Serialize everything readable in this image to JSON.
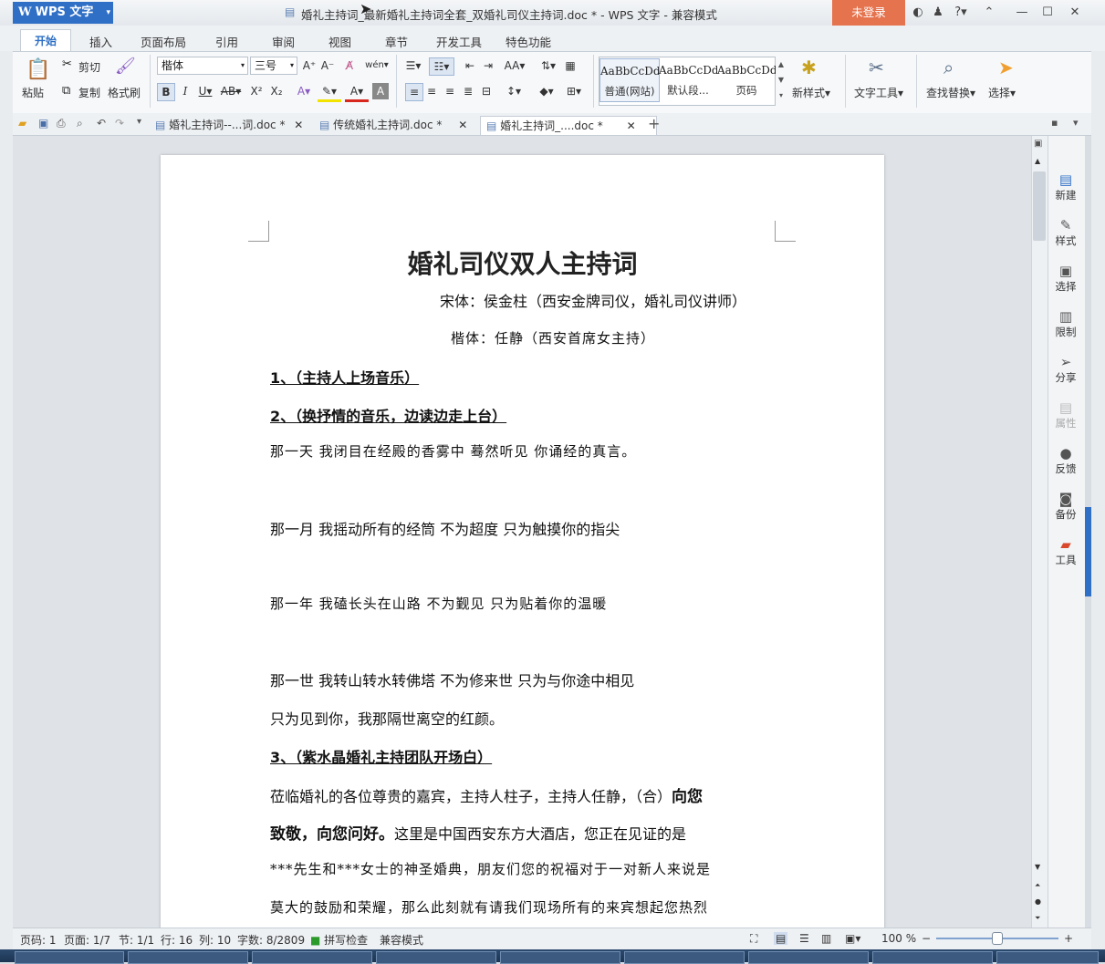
{
  "titlebar": {
    "app_name": "WPS 文字",
    "title": "婚礼主持词_最新婚礼主持词全套_双婚礼司仪主持词.doc * - WPS 文字 - 兼容模式",
    "login": "未登录"
  },
  "menu": {
    "tabs": [
      "开始",
      "插入",
      "页面布局",
      "引用",
      "审阅",
      "视图",
      "章节",
      "开发工具",
      "特色功能"
    ]
  },
  "ribbon": {
    "paste": "粘贴",
    "cut": "剪切",
    "copy": "复制",
    "format_painter": "格式刷",
    "font_name": "楷体",
    "font_size": "三号",
    "styles": [
      {
        "sample": "AaBbCcDd",
        "name": "普通(网站)"
      },
      {
        "sample": "AaBbCcDd",
        "name": "默认段..."
      },
      {
        "sample": "AaBbCcDd",
        "name": "页码"
      }
    ],
    "new_style": "新样式",
    "text_tools": "文字工具",
    "find_replace": "查找替换",
    "select": "选择"
  },
  "doctabs": [
    {
      "label": "婚礼主持词--...词.doc *"
    },
    {
      "label": "传统婚礼主持词.doc *"
    },
    {
      "label": "婚礼主持词_....doc *"
    }
  ],
  "document": {
    "title": "婚礼司仪双人主持词",
    "line1": "宋体：侯金柱（西安金牌司仪，婚礼司仪讲师）",
    "line2": "楷体：任静（西安首席女主持）",
    "h1": "1、（主持人上场音乐）",
    "h2": "2、（换抒情的音乐，边读边走上台）",
    "p1": "那一天 我闭目在经殿的香雾中 蓦然听见 你诵经的真言。",
    "p2": "那一月 我摇动所有的经筒 不为超度 只为触摸你的指尖",
    "p3": "那一年 我磕长头在山路 不为觐见 只为贴着你的温暖",
    "p4": "那一世 我转山转水转佛塔 不为修来世 只为与你途中相见",
    "p5": "只为见到你，我那隔世离空的红颜。",
    "h3": "3、（紫水晶婚礼主持团队开场白）",
    "p6a": "莅临婚礼的各位尊贵的嘉宾，主持人柱子，主持人任静，（合）",
    "p6b": "向您",
    "p7a": "致敬，向您问好。",
    "p7b": "这里是中国西安东方大酒店，您正在见证的是",
    "p8": "***先生和***女士的神圣婚典，朋友们您的祝福对于一对新人来说是",
    "p9": "莫大的鼓励和荣耀，那么此刻就有请我们现场所有的来宾想起您热烈"
  },
  "rightpanel": [
    "新建",
    "样式",
    "选择",
    "限制",
    "分享",
    "属性",
    "反馈",
    "备份",
    "工具"
  ],
  "status": {
    "page_code": "页码: 1",
    "pages": "页面: 1/7",
    "section": "节: 1/1",
    "row": "行: 16",
    "col": "列: 10",
    "words": "字数: 8/2809",
    "spell": "拼写检查",
    "compat": "兼容模式",
    "zoom": "100 %",
    "zoom_level": 0.5
  }
}
